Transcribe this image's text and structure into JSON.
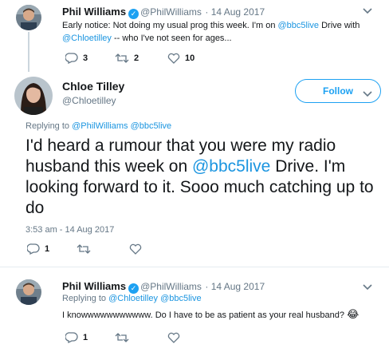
{
  "tweet1": {
    "name": "Phil Williams",
    "handle": "@PhilWilliams",
    "date": "· 14 Aug 2017",
    "text_line1": "Early notice: Not doing my usual prog this week. I'm on",
    "mention1": "@bbc5live",
    "text_line1b": "Drive with",
    "mention2": "@Chloetilley",
    "text_line2b": "-- who I've not seen for ages...",
    "replies": "3",
    "retweets": "2",
    "likes": "10"
  },
  "main": {
    "name": "Chloe Tilley",
    "handle": "@Chloetilley",
    "follow_label": "Follow",
    "replying_prefix": "Replying to",
    "replying_to1": "@PhilWilliams",
    "replying_to2": "@bbc5live",
    "text_a": "I'd heard a rumour that you were my radio husband this week on",
    "mention": "@bbc5live",
    "text_b": "Drive. I'm looking forward to it. Sooo much catching up to do",
    "timestamp": "3:53 am - 14 Aug 2017",
    "replies": "1"
  },
  "tweet3": {
    "name": "Phil Williams",
    "handle": "@PhilWilliams",
    "date": "· 14 Aug 2017",
    "replying_prefix": "Replying to",
    "replying_to1": "@Chloetilley",
    "replying_to2": "@bbc5live",
    "text": "I knowwwwwwwwwww. Do I have to be as patient as your real husband?",
    "emoji": "😂",
    "replies": "1"
  },
  "colors": {
    "accent": "#1da1f2",
    "link": "#1b95e0",
    "muted": "#657786"
  }
}
